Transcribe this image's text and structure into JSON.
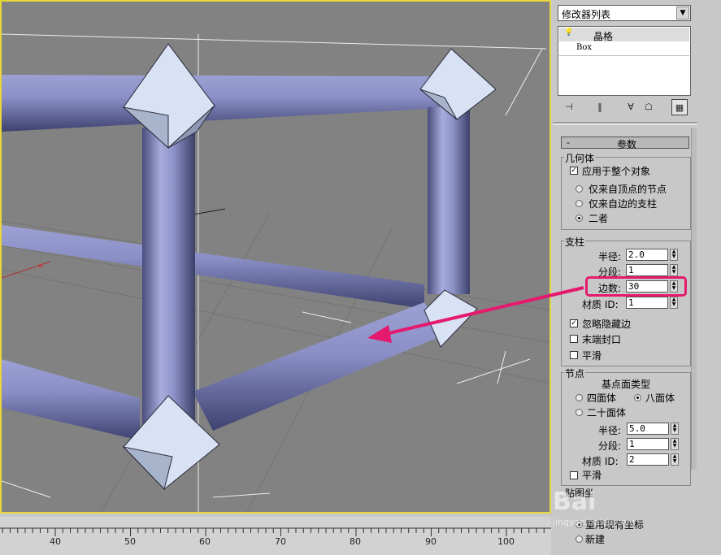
{
  "modifier_list_label": "修改器列表",
  "stack": {
    "selected_item": "晶格",
    "base_item": "Box"
  },
  "params_rollout": {
    "toggle": "-",
    "title": "参数"
  },
  "geometry": {
    "label": "几何体",
    "apply_whole": "应用于整个对象",
    "apply_whole_checked": true,
    "radios": [
      "仅来自顶点的节点",
      "仅来自边的支柱",
      "二者"
    ],
    "selected_radio": "二者"
  },
  "struts": {
    "label": "支柱",
    "radius_label": "半径:",
    "radius_value": "2.0",
    "segments_label": "分段:",
    "segments_value": "1",
    "sides_label": "边数:",
    "sides_value": "30",
    "material_label": "材质 ID:",
    "material_value": "1",
    "ignore_hidden": "忽略隐藏边",
    "ignore_hidden_checked": true,
    "end_caps": "末端封口",
    "smooth": "平滑"
  },
  "joints": {
    "label": "节点",
    "geodesic_label": "基点面类型",
    "types": [
      "四面体",
      "八面体",
      "二十面体"
    ],
    "selected_type": "八面体",
    "radius_label": "半径:",
    "radius_value": "5.0",
    "segments_label": "分段:",
    "segments_value": "1",
    "material_label": "材质 ID:",
    "material_value": "2",
    "smooth": "平滑"
  },
  "mapping": {
    "label": "贴图坐",
    "use_existing": "重用现有坐标",
    "new": "新建"
  },
  "ruler_ticks": [
    "40",
    "50",
    "60",
    "70",
    "80",
    "90",
    "100"
  ],
  "watermark": "Bai",
  "watermark_sub": "jingyan.baidu.com",
  "colors": {
    "viewport_bg": "#828282",
    "viewport_border": "#e8d63a",
    "strut": "#8a8fc6",
    "joint": "#d8e2f4",
    "highlight": "#e5196e"
  }
}
